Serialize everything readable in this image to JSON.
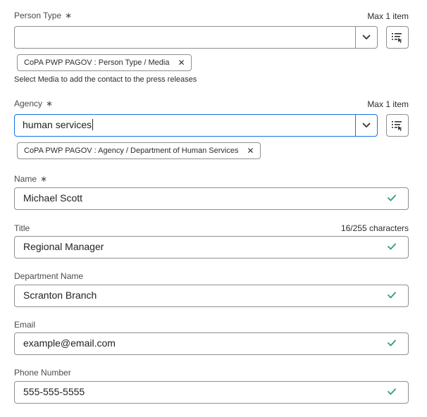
{
  "person_type": {
    "label": "Person Type",
    "required_mark": "∗",
    "limit": "Max 1 item",
    "value": "",
    "tag": "CoPA PWP PAGOV : Person Type / Media",
    "help": "Select Media to add the contact to the press releases"
  },
  "agency": {
    "label": "Agency",
    "required_mark": "∗",
    "limit": "Max 1 item",
    "value": "human services",
    "tag": "CoPA PWP PAGOV : Agency / Department of Human Services"
  },
  "name": {
    "label": "Name",
    "required_mark": "∗",
    "value": "Michael Scott"
  },
  "title": {
    "label": "Title",
    "char_count": "16/255 characters",
    "value": "Regional Manager"
  },
  "department": {
    "label": "Department Name",
    "value": "Scranton Branch"
  },
  "email": {
    "label": "Email",
    "value": "example@email.com"
  },
  "phone": {
    "label": "Phone Number",
    "value": "555-555-5555"
  },
  "icons": {
    "dropdown": "chevron-down-icon",
    "picker": "list-picker-icon",
    "remove": "close-icon",
    "valid": "checkmark-icon"
  },
  "colors": {
    "valid_check": "#2d9d78",
    "focus_border": "#1473e6",
    "border": "#8f8f8f"
  }
}
